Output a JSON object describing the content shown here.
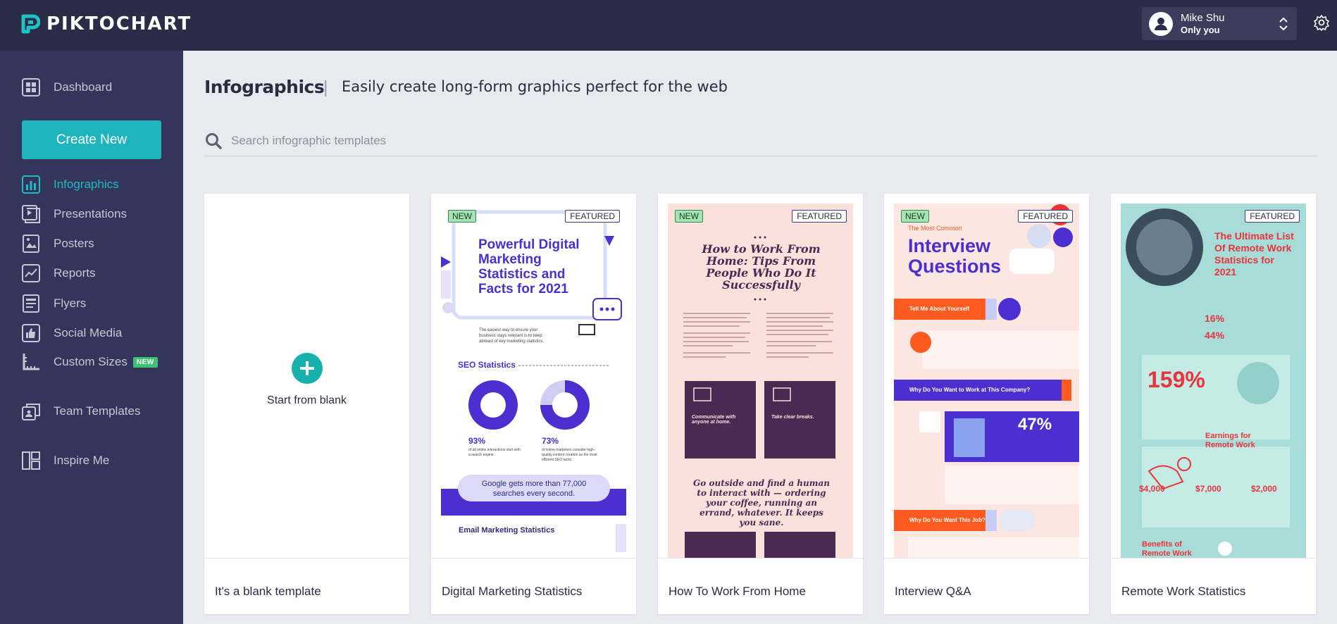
{
  "brand": {
    "name": "PIKTOCHART"
  },
  "user": {
    "name": "Mike Shu",
    "scope": "Only you"
  },
  "sidebar": {
    "items": [
      {
        "label": "Dashboard",
        "icon": "dashboard-icon"
      },
      {
        "label": "Infographics",
        "icon": "bar-chart-icon",
        "active": true
      },
      {
        "label": "Presentations",
        "icon": "presentation-icon"
      },
      {
        "label": "Posters",
        "icon": "poster-icon"
      },
      {
        "label": "Reports",
        "icon": "report-icon"
      },
      {
        "label": "Flyers",
        "icon": "flyer-icon"
      },
      {
        "label": "Social Media",
        "icon": "thumbs-up-icon"
      },
      {
        "label": "Custom Sizes",
        "icon": "ruler-icon",
        "badge": "NEW"
      },
      {
        "label": "Team Templates",
        "icon": "team-templates-icon"
      },
      {
        "label": "Inspire Me",
        "icon": "inspire-icon"
      }
    ],
    "create_label": "Create New"
  },
  "main": {
    "title": "Infographics",
    "separator": "|",
    "subtitle": "Easily create long-form graphics perfect for the web",
    "search_placeholder": "Search infographic templates"
  },
  "cards": [
    {
      "label": "It's a blank template",
      "action": "Start from blank"
    },
    {
      "label": "Digital Marketing Statistics",
      "new": "NEW",
      "featured": "FEATURED",
      "thumb": {
        "headline": "Powerful Digital Marketing Statistics and Facts for 2021",
        "intro": "The easiest way to ensure your business stays relevant is to keep abreast of key marketing statistics.",
        "section": "SEO Statistics",
        "stat1": "93%",
        "stat1_text": "of all online interactions start with a search engine.",
        "stat2": "73%",
        "stat2_text": "of online marketers consider high-quality content creation as the most efficient SEO tactic.",
        "callout": "Google gets more than 77,000 searches every second.",
        "section2": "Email Marketing Statistics"
      }
    },
    {
      "label": "How To Work From Home",
      "new": "NEW",
      "featured": "FEATURED",
      "thumb": {
        "headline": "How to Work From Home: Tips From People Who Do It Successfully",
        "tip1": "Communicate with anyone at home.",
        "tip2": "Take clear breaks.",
        "quote": "Go outside and find a human to interact with — ordering your coffee, running an errand, whatever. It keeps you sane."
      }
    },
    {
      "label": "Interview Q&A",
      "new": "NEW",
      "featured": "FEATURED",
      "thumb": {
        "kicker": "The Most Common",
        "headline": "Interview Questions",
        "q1": "Tell Me About Yourself",
        "q2": "Why Do You Want to Work at This Company?",
        "stat": "47%",
        "q3": "Why Do You Want This Job?"
      }
    },
    {
      "label": "Remote Work Statistics",
      "featured": "FEATURED",
      "thumb": {
        "headline": "The Ultimate List Of Remote Work Statistics for 2021",
        "s1": "16%",
        "s2": "44%",
        "big": "159%",
        "earn": "Earnings for Remote Work",
        "v1": "$4,000",
        "v2": "$7,000",
        "v3": "$2,000",
        "benefits": "Benefits of Remote Work"
      }
    }
  ],
  "colors": {
    "topbar": "#2a2c48",
    "sidebar": "#33355a",
    "accent": "#1fb5be",
    "background": "#e8eaef"
  }
}
